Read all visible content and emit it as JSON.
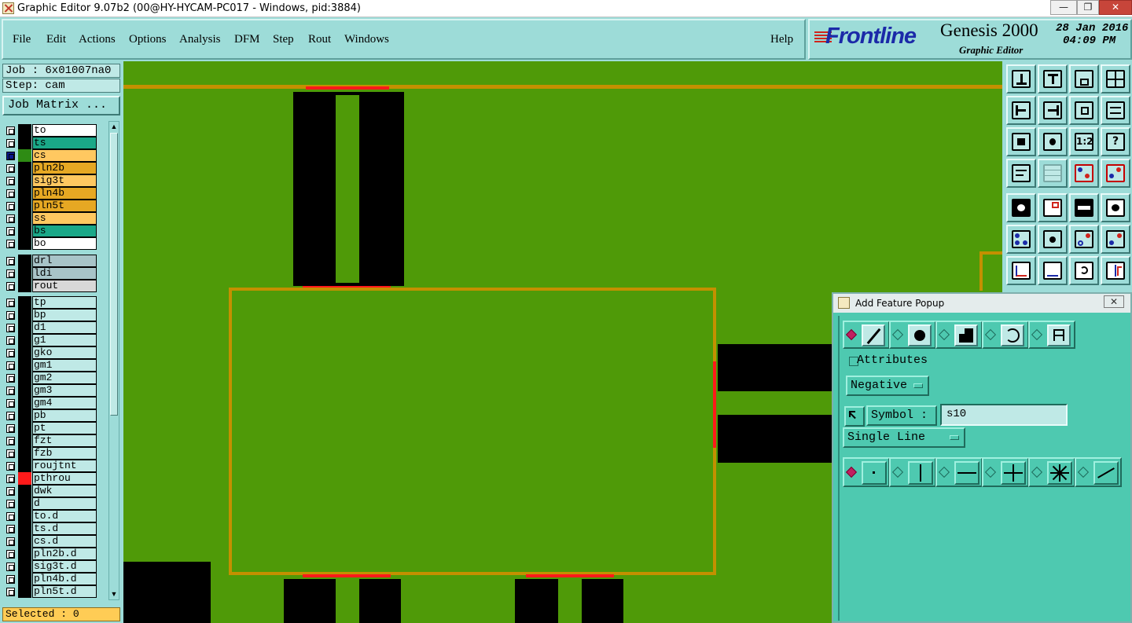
{
  "window": {
    "title": "Graphic Editor 9.07b2 (00@HY-HYCAM-PC017 - Windows, pid:3884)",
    "min_glyph": "—",
    "max_glyph": "❐",
    "close_glyph": "✕"
  },
  "menu": {
    "items": [
      {
        "label": "File"
      },
      {
        "label": "Edit"
      },
      {
        "label": "Actions"
      },
      {
        "label": "Options"
      },
      {
        "label": "Analysis"
      },
      {
        "label": "DFM"
      },
      {
        "label": "Step"
      },
      {
        "label": "Rout"
      },
      {
        "label": "Windows"
      }
    ],
    "help": "Help"
  },
  "brand": {
    "logo": "Frontline",
    "product": "Genesis 2000",
    "subtitle": "Graphic Editor",
    "date": "28 Jan 2016",
    "time": "04:09 PM"
  },
  "job": {
    "job_line": "Job : 6x01007na0",
    "step_line": "Step: cam",
    "matrix_button": "Job Matrix ..."
  },
  "layers": {
    "board": [
      {
        "name": "to",
        "color": "#ffffff",
        "swatch": "black",
        "checked": false
      },
      {
        "name": "ts",
        "color": "#1aa888",
        "swatch": "black",
        "checked": false
      },
      {
        "name": "cs",
        "color": "#ffc860",
        "swatch": "green",
        "checked": true
      },
      {
        "name": "pln2b",
        "color": "#e6a823",
        "swatch": "black",
        "checked": false
      },
      {
        "name": "sig3t",
        "color": "#ffc860",
        "swatch": "black",
        "checked": false
      },
      {
        "name": "pln4b",
        "color": "#e6a823",
        "swatch": "black",
        "checked": false
      },
      {
        "name": "pln5t",
        "color": "#e6a823",
        "swatch": "black",
        "checked": false
      },
      {
        "name": "ss",
        "color": "#ffc860",
        "swatch": "black",
        "checked": false
      },
      {
        "name": "bs",
        "color": "#1aa888",
        "swatch": "black",
        "checked": false
      },
      {
        "name": "bo",
        "color": "#ffffff",
        "swatch": "black",
        "checked": false
      }
    ],
    "drill": [
      {
        "name": "drl",
        "color": "#a8c4c8",
        "swatch": "black",
        "checked": false
      },
      {
        "name": "ldi",
        "color": "#a8c4c8",
        "swatch": "black",
        "checked": false
      },
      {
        "name": "rout",
        "color": "#d8d8d8",
        "swatch": "black",
        "checked": false
      }
    ],
    "misc": [
      {
        "name": "tp",
        "color": "#bfe9e6",
        "swatch": "black",
        "checked": false
      },
      {
        "name": "bp",
        "color": "#bfe9e6",
        "swatch": "black",
        "checked": false
      },
      {
        "name": "d1",
        "color": "#bfe9e6",
        "swatch": "black",
        "checked": false
      },
      {
        "name": "g1",
        "color": "#bfe9e6",
        "swatch": "black",
        "checked": false
      },
      {
        "name": "gko",
        "color": "#bfe9e6",
        "swatch": "black",
        "checked": false
      },
      {
        "name": "gm1",
        "color": "#bfe9e6",
        "swatch": "black",
        "checked": false
      },
      {
        "name": "gm2",
        "color": "#bfe9e6",
        "swatch": "black",
        "checked": false
      },
      {
        "name": "gm3",
        "color": "#bfe9e6",
        "swatch": "black",
        "checked": false
      },
      {
        "name": "gm4",
        "color": "#bfe9e6",
        "swatch": "black",
        "checked": false
      },
      {
        "name": "pb",
        "color": "#bfe9e6",
        "swatch": "black",
        "checked": false
      },
      {
        "name": "pt",
        "color": "#bfe9e6",
        "swatch": "black",
        "checked": false
      },
      {
        "name": "fzt",
        "color": "#bfe9e6",
        "swatch": "black",
        "checked": false
      },
      {
        "name": "fzb",
        "color": "#bfe9e6",
        "swatch": "black",
        "checked": false
      },
      {
        "name": "roujtnt",
        "color": "#bfe9e6",
        "swatch": "black",
        "checked": false
      },
      {
        "name": "pthrou",
        "color": "#bfe9e6",
        "swatch": "red",
        "checked": false
      },
      {
        "name": "dwk",
        "color": "#bfe9e6",
        "swatch": "black",
        "checked": false
      },
      {
        "name": "d",
        "color": "#bfe9e6",
        "swatch": "black",
        "checked": false
      },
      {
        "name": "to.d",
        "color": "#bfe9e6",
        "swatch": "black",
        "checked": false
      },
      {
        "name": "ts.d",
        "color": "#bfe9e6",
        "swatch": "black",
        "checked": false
      },
      {
        "name": "cs.d",
        "color": "#bfe9e6",
        "swatch": "black",
        "checked": false
      },
      {
        "name": "pln2b.d",
        "color": "#bfe9e6",
        "swatch": "black",
        "checked": false
      },
      {
        "name": "sig3t.d",
        "color": "#bfe9e6",
        "swatch": "black",
        "checked": false
      },
      {
        "name": "pln4b.d",
        "color": "#bfe9e6",
        "swatch": "black",
        "checked": false
      },
      {
        "name": "pln5t.d",
        "color": "#bfe9e6",
        "swatch": "black",
        "checked": false
      }
    ]
  },
  "status": {
    "selected": "Selected : 0"
  },
  "popup": {
    "title": "Add Feature Popup",
    "close_glyph": "✕",
    "attributes_label": "Attributes",
    "polarity": "Negative",
    "symbol_button": "Symbol :",
    "symbol_value": "s10",
    "line_mode": "Single Line",
    "feature_types": [
      "line",
      "pad",
      "surface",
      "arc",
      "text"
    ],
    "selected_feature_type": "line",
    "draw_modes": [
      "point",
      "vertical",
      "horizontal",
      "cross",
      "star",
      "free"
    ],
    "selected_draw_mode": "point"
  },
  "colors": {
    "canvas": "#4f9a08",
    "copper": "#000000",
    "outline": "#c49000",
    "highlight": "#ff1a1a",
    "panel": "#9ddcd8",
    "popup": "#4ec9b0"
  }
}
